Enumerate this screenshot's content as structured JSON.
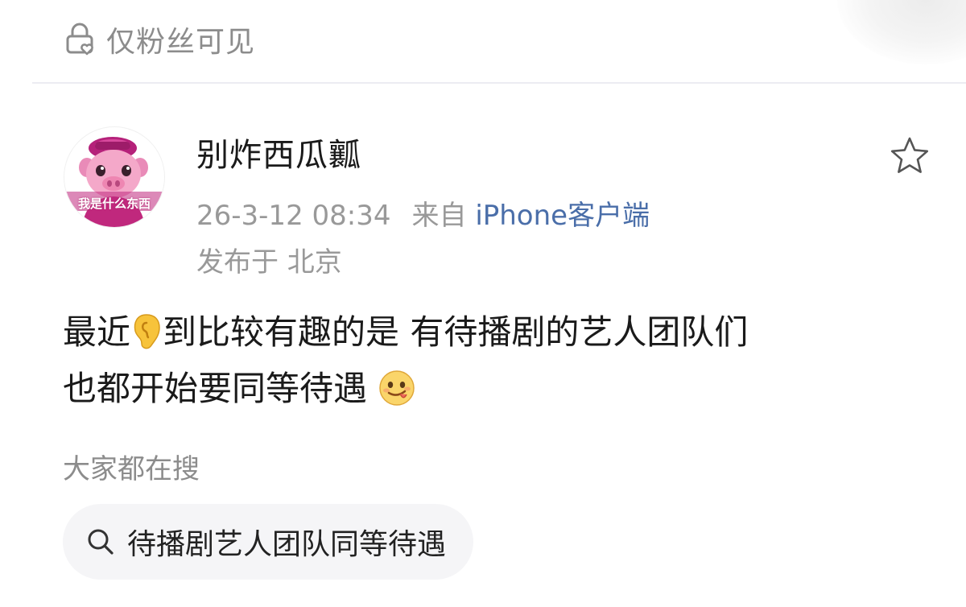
{
  "visibility": {
    "icon": "lock-heart-icon",
    "label": "仅粉丝可见"
  },
  "post": {
    "author": {
      "name": "别炸西瓜瓤",
      "avatar_caption": "我是什么东西"
    },
    "meta": {
      "timestamp": "26-3-12 08:34",
      "source_prefix": "来自",
      "source_app": "iPhone客户端",
      "location": "发布于 北京"
    },
    "favorite_icon": "star-outline-icon",
    "content": {
      "line1_before_emoji": "最近",
      "emoji1": "ear-emoji",
      "line1_after_emoji": "到比较有趣的是 有待播剧的艺人团队们",
      "line2_before_emoji": "也都开始要同等待遇",
      "emoji2": "tongue-face-emoji"
    }
  },
  "trending": {
    "heading": "大家都在搜",
    "search_icon": "search-icon",
    "query": "待播剧艺人团队同等待遇"
  },
  "colors": {
    "meta_gray": "#999999",
    "link_blue": "#4a6ea9",
    "chip_bg": "#f5f5f7",
    "divider": "#ececf2"
  }
}
